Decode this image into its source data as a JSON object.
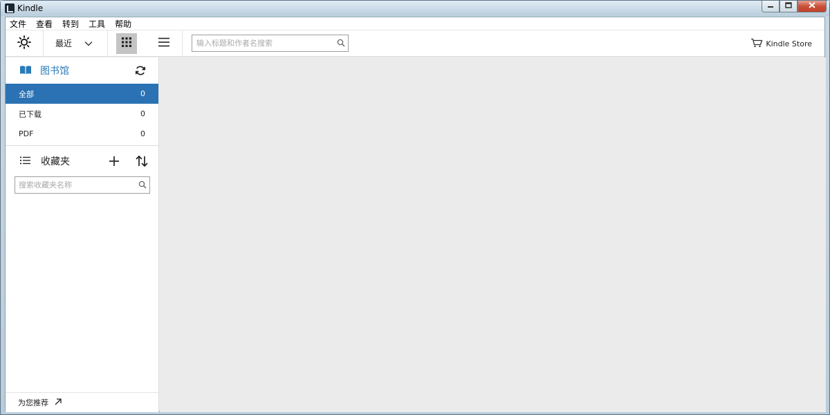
{
  "window": {
    "title": "Kindle",
    "controls": {
      "minimize": "▁",
      "maximize": "▭",
      "close": "✕"
    }
  },
  "menu": [
    "文件",
    "查看",
    "转到",
    "工具",
    "帮助"
  ],
  "toolbar": {
    "sort_label": "最近",
    "search_placeholder": "输入标题和作者名搜索",
    "store_label": "Kindle Store",
    "icons": [
      "brightness-icon",
      "chevron-down-icon",
      "grid-view-icon",
      "list-view-icon",
      "search-icon",
      "cart-icon"
    ]
  },
  "sidebar": {
    "library_title": "图书馆",
    "library_items": [
      {
        "label": "全部",
        "count": "0",
        "active": true
      },
      {
        "label": "已下载",
        "count": "0",
        "active": false
      },
      {
        "label": "PDF",
        "count": "0",
        "active": false
      }
    ],
    "collections_title": "收藏夹",
    "collections_search_placeholder": "搜索收藏夹名称",
    "recommend_label": "为您推荐"
  },
  "colors": {
    "accent": "#2b72b4",
    "library_title": "#2a7ab8",
    "content_bg": "#ebebeb"
  }
}
